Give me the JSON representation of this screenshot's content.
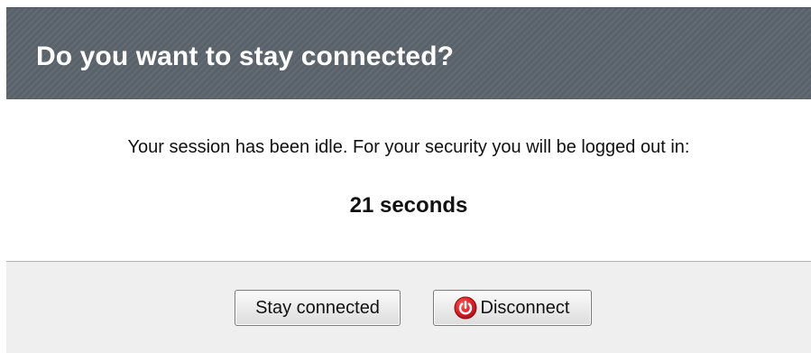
{
  "dialog": {
    "title": "Do you want to stay connected?",
    "message": "Your session has been idle. For your security you will be logged out in:",
    "countdown": "21 seconds"
  },
  "buttons": {
    "stay_label": "Stay connected",
    "disconnect_label": "Disconnect",
    "disconnect_icon": "power-icon"
  },
  "colors": {
    "header_bg": "#5b636c",
    "header_text": "#ffffff",
    "footer_bg": "#efefef",
    "power_icon": "#d9202a"
  }
}
